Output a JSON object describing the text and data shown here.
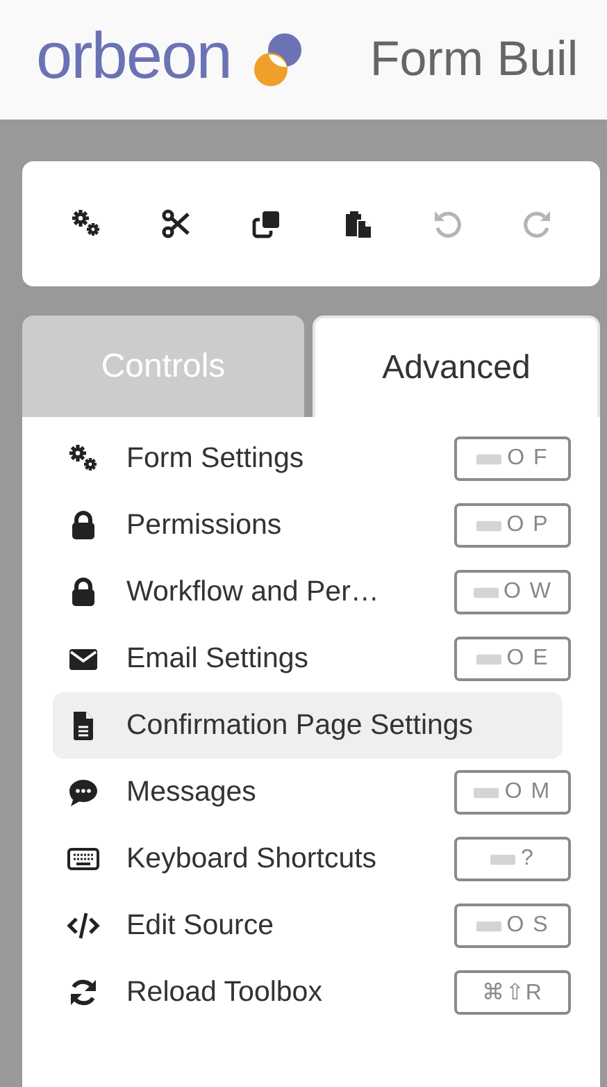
{
  "header": {
    "logo": "orbeon",
    "title": "Form Buil"
  },
  "toolbar": [
    {
      "kind": "settings",
      "disabled": false
    },
    {
      "kind": "cut",
      "disabled": false
    },
    {
      "kind": "copy",
      "disabled": false
    },
    {
      "kind": "paste",
      "disabled": false
    },
    {
      "kind": "undo",
      "disabled": true
    },
    {
      "kind": "redo",
      "disabled": true
    }
  ],
  "tabs": [
    {
      "label": "Controls",
      "selected": false
    },
    {
      "label": "Advanced",
      "selected": true
    }
  ],
  "items": [
    {
      "kind": "settings",
      "label": "Form Settings",
      "selected": false,
      "shortcut": {
        "keys": "O F",
        "keyboard_icon": true
      }
    },
    {
      "kind": "lock",
      "label": "Permissions",
      "selected": false,
      "shortcut": {
        "keys": "O P",
        "keyboard_icon": true
      }
    },
    {
      "kind": "lock",
      "label": "Workflow and Per…",
      "selected": false,
      "shortcut": {
        "keys": "O W",
        "keyboard_icon": true
      }
    },
    {
      "kind": "envelope",
      "label": "Email Settings",
      "selected": false,
      "shortcut": {
        "keys": "O E",
        "keyboard_icon": true
      }
    },
    {
      "kind": "document",
      "label": "Confirmation Page Settings",
      "selected": true
    },
    {
      "kind": "chat",
      "label": "Messages",
      "selected": false,
      "shortcut": {
        "keys": "O M",
        "keyboard_icon": true
      }
    },
    {
      "kind": "keyboard",
      "label": "Keyboard Shortcuts",
      "selected": false,
      "shortcut": {
        "keys": "?",
        "keyboard_icon": true
      }
    },
    {
      "kind": "code",
      "label": "Edit Source",
      "selected": false,
      "shortcut": {
        "keys": "O S",
        "keyboard_icon": true
      }
    },
    {
      "kind": "reload",
      "label": "Reload Toolbox",
      "selected": false,
      "shortcut": {
        "keys": "⌘⇧R",
        "keyboard_icon": false
      }
    }
  ]
}
